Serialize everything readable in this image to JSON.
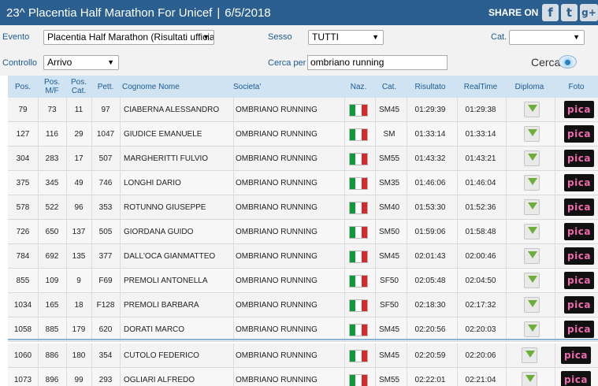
{
  "header": {
    "title": "23^ Placentia Half Marathon For Unicef",
    "separator": "|",
    "date": "6/5/2018",
    "share_label": "SHARE ON",
    "facebook": "f",
    "twitter": "t",
    "googleplus": "g+"
  },
  "filters": {
    "evento_label": "Evento",
    "evento_value": "Placentia Half Marathon (Risultati ufficiali)",
    "sesso_label": "Sesso",
    "sesso_value": "TUTTI",
    "cat_label": "Cat.",
    "cat_value": "",
    "controllo_label": "Controllo",
    "controllo_value": "Arrivo",
    "cerca_per_label": "Cerca per",
    "cerca_per_value": "ombriano running",
    "cerca_button": "Cerca",
    "arrow": "▼"
  },
  "table": {
    "headers": {
      "pos": "Pos.",
      "pos_mf": "Pos.\nM/F",
      "pos_cat": "Pos.\nCat.",
      "pett": "Pett.",
      "nome": "Cognome Nome",
      "societa": "Societa'",
      "naz": "Naz.",
      "cat": "Cat.",
      "risultato": "Risultato",
      "realtime": "RealTime",
      "diploma": "Diploma",
      "foto": "Foto"
    },
    "pica_label": "pica",
    "flag_colors": [
      "#0f9a3a",
      "#ffffff",
      "#d22b2b"
    ],
    "rows": [
      {
        "pos": "79",
        "pos_mf": "73",
        "pos_cat": "11",
        "pett": "97",
        "nome": "CIABERNA ALESSANDRO",
        "societa": "OMBRIANO RUNNING",
        "cat": "SM45",
        "risultato": "01:29:39",
        "realtime": "01:29:38"
      },
      {
        "pos": "127",
        "pos_mf": "116",
        "pos_cat": "29",
        "pett": "1047",
        "nome": "GIUDICE EMANUELE",
        "societa": "OMBRIANO RUNNING",
        "cat": "SM",
        "risultato": "01:33:14",
        "realtime": "01:33:14"
      },
      {
        "pos": "304",
        "pos_mf": "283",
        "pos_cat": "17",
        "pett": "507",
        "nome": "MARGHERITTI FULVIO",
        "societa": "OMBRIANO RUNNING",
        "cat": "SM55",
        "risultato": "01:43:32",
        "realtime": "01:43:21"
      },
      {
        "pos": "375",
        "pos_mf": "345",
        "pos_cat": "49",
        "pett": "746",
        "nome": "LONGHI DARIO",
        "societa": "OMBRIANO RUNNING",
        "cat": "SM35",
        "risultato": "01:46:06",
        "realtime": "01:46:04"
      },
      {
        "pos": "578",
        "pos_mf": "522",
        "pos_cat": "96",
        "pett": "353",
        "nome": "ROTUNNO GIUSEPPE",
        "societa": "OMBRIANO RUNNING",
        "cat": "SM40",
        "risultato": "01:53:30",
        "realtime": "01:52:36"
      },
      {
        "pos": "726",
        "pos_mf": "650",
        "pos_cat": "137",
        "pett": "505",
        "nome": "GIORDANA GUIDO",
        "societa": "OMBRIANO RUNNING",
        "cat": "SM50",
        "risultato": "01:59:06",
        "realtime": "01:58:48"
      },
      {
        "pos": "784",
        "pos_mf": "692",
        "pos_cat": "135",
        "pett": "377",
        "nome": "DALL'OCA GIANMATTEO",
        "societa": "OMBRIANO RUNNING",
        "cat": "SM45",
        "risultato": "02:01:43",
        "realtime": "02:00:46"
      },
      {
        "pos": "855",
        "pos_mf": "109",
        "pos_cat": "9",
        "pett": "F69",
        "nome": "PREMOLI ANTONELLA",
        "societa": "OMBRIANO RUNNING",
        "cat": "SF50",
        "risultato": "02:05:48",
        "realtime": "02:04:50"
      },
      {
        "pos": "1034",
        "pos_mf": "165",
        "pos_cat": "18",
        "pett": "F128",
        "nome": "PREMOLI BARBARA",
        "societa": "OMBRIANO RUNNING",
        "cat": "SF50",
        "risultato": "02:18:30",
        "realtime": "02:17:32"
      },
      {
        "pos": "1058",
        "pos_mf": "885",
        "pos_cat": "179",
        "pett": "620",
        "nome": "DORATI MARCO",
        "societa": "OMBRIANO RUNNING",
        "cat": "SM45",
        "risultato": "02:20:56",
        "realtime": "02:20:03"
      },
      {
        "pos": "1060",
        "pos_mf": "886",
        "pos_cat": "180",
        "pett": "354",
        "nome": "CUTOLO FEDERICO",
        "societa": "OMBRIANO RUNNING",
        "cat": "SM45",
        "risultato": "02:20:59",
        "realtime": "02:20:06"
      },
      {
        "pos": "1073",
        "pos_mf": "896",
        "pos_cat": "99",
        "pett": "293",
        "nome": "OGLIARI ALFREDO",
        "societa": "OMBRIANO RUNNING",
        "cat": "SM55",
        "risultato": "02:22:01",
        "realtime": "02:21:04"
      }
    ]
  }
}
